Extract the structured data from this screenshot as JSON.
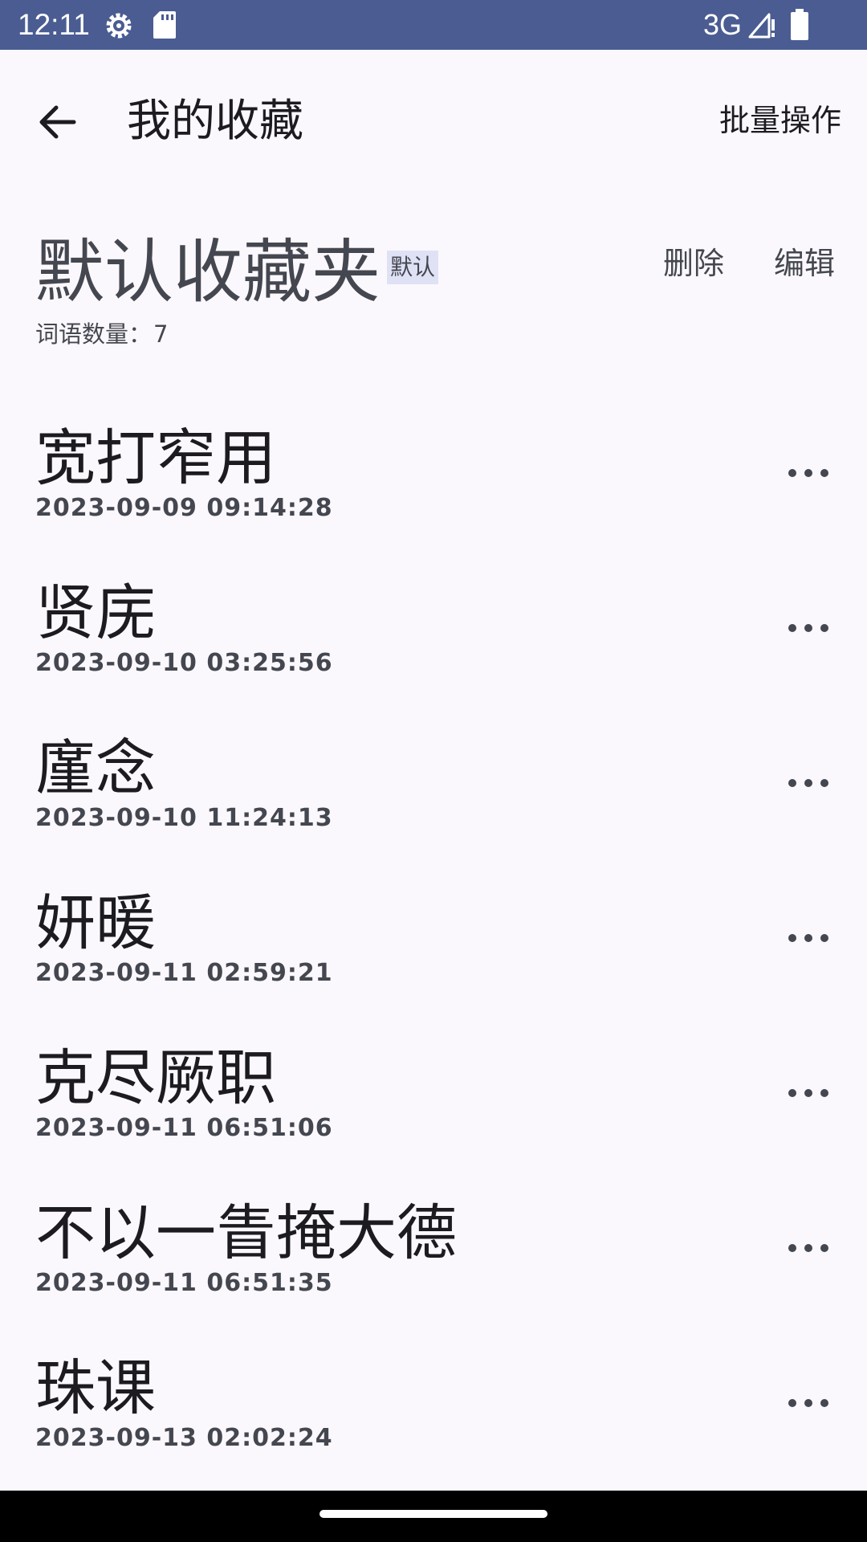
{
  "status_bar": {
    "time": "12:11",
    "network": "3G",
    "background_color": "#4a5c92",
    "icons": [
      "gear-icon",
      "sd-card-icon",
      "signal-icon",
      "battery-icon"
    ]
  },
  "app_bar": {
    "title": "我的收藏",
    "batch_label": "批量操作",
    "back_icon": "arrow-back-icon"
  },
  "folder": {
    "name": "默认收藏夹",
    "badge": "默认",
    "delete_label": "删除",
    "edit_label": "编辑",
    "count_label": "词语数量：",
    "count_value": "7"
  },
  "items": [
    {
      "word": "宽打窄用",
      "time": "2023-09-09 09:14:28"
    },
    {
      "word": "贤庑",
      "time": "2023-09-10 03:25:56"
    },
    {
      "word": "廑念",
      "time": "2023-09-10 11:24:13"
    },
    {
      "word": "妍暖",
      "time": "2023-09-11 02:59:21"
    },
    {
      "word": "克尽厥职",
      "time": "2023-09-11 06:51:06"
    },
    {
      "word": "不以一眚掩大德",
      "time": "2023-09-11 06:51:35"
    },
    {
      "word": "珠课",
      "time": "2023-09-13 02:02:24"
    }
  ]
}
